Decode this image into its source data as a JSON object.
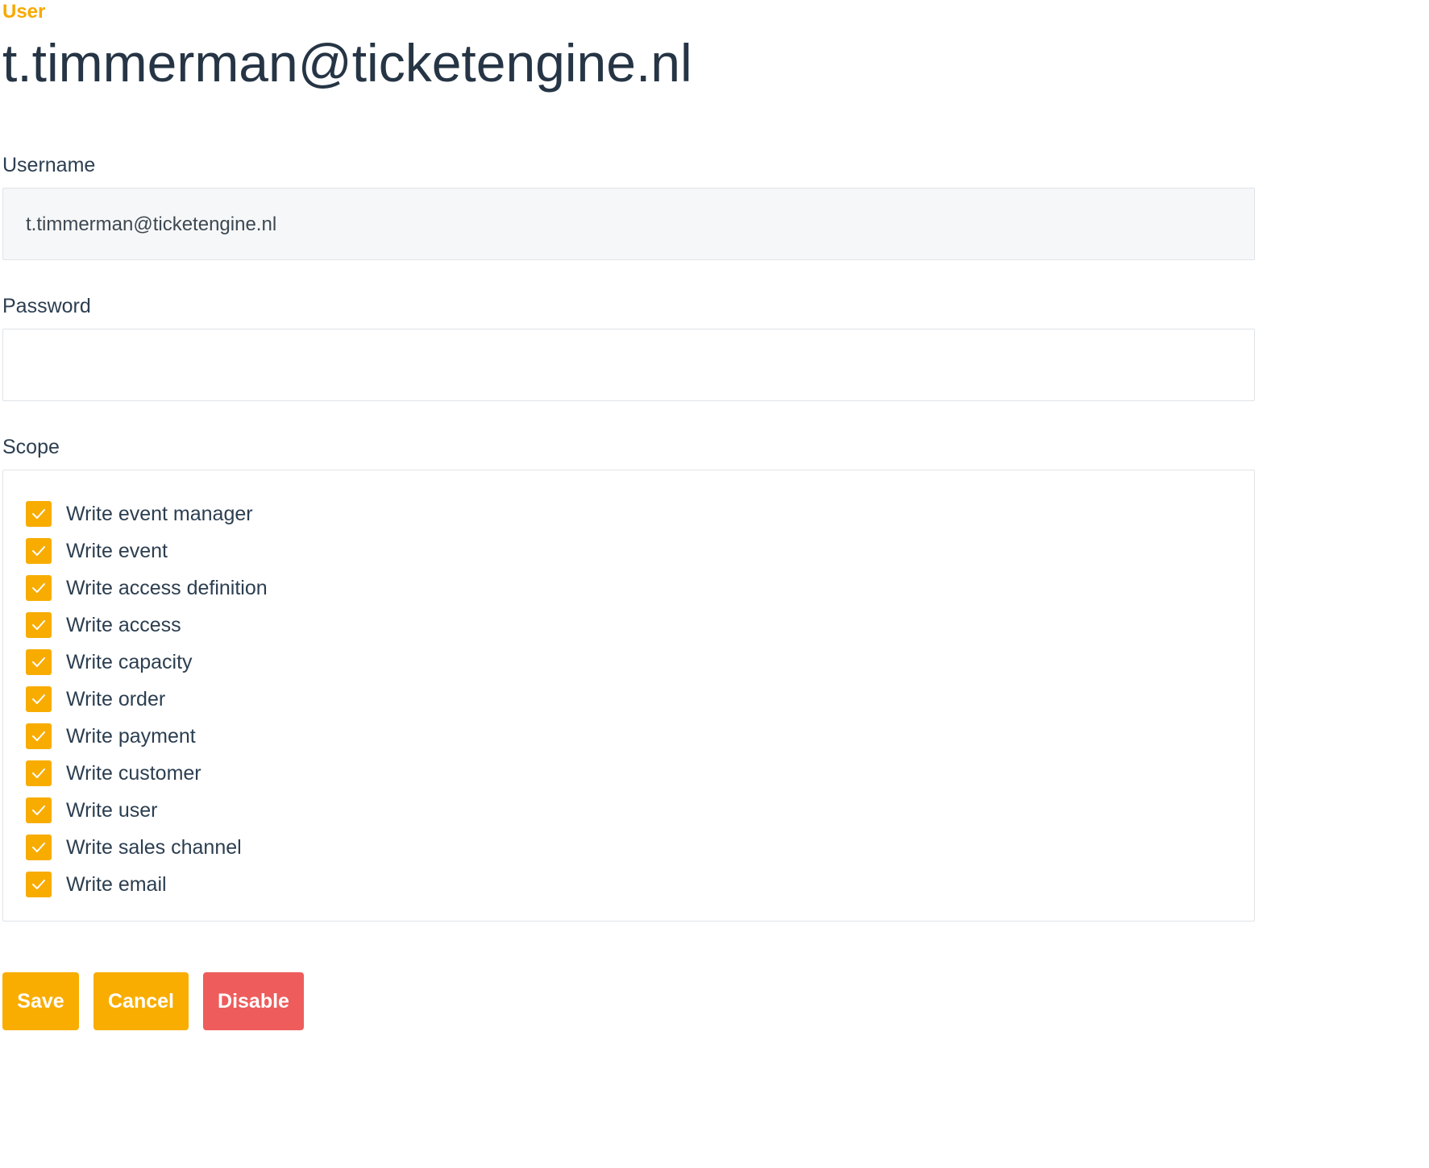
{
  "header": {
    "eyebrow": "User",
    "title": "t.timmerman@ticketengine.nl"
  },
  "form": {
    "username": {
      "label": "Username",
      "value": "t.timmerman@ticketengine.nl"
    },
    "password": {
      "label": "Password",
      "value": ""
    },
    "scope": {
      "label": "Scope",
      "items": [
        {
          "label": "Write event manager",
          "checked": true
        },
        {
          "label": "Write event",
          "checked": true
        },
        {
          "label": "Write access definition",
          "checked": true
        },
        {
          "label": "Write access",
          "checked": true
        },
        {
          "label": "Write capacity",
          "checked": true
        },
        {
          "label": "Write order",
          "checked": true
        },
        {
          "label": "Write payment",
          "checked": true
        },
        {
          "label": "Write customer",
          "checked": true
        },
        {
          "label": "Write user",
          "checked": true
        },
        {
          "label": "Write sales channel",
          "checked": true
        },
        {
          "label": "Write email",
          "checked": true
        }
      ]
    }
  },
  "actions": {
    "save_label": "Save",
    "cancel_label": "Cancel",
    "disable_label": "Disable"
  },
  "colors": {
    "accent": "#f9ad00",
    "danger": "#ee5c5c",
    "text": "#2c3e50"
  },
  "icons": {
    "checkbox": "checkmark-icon"
  }
}
